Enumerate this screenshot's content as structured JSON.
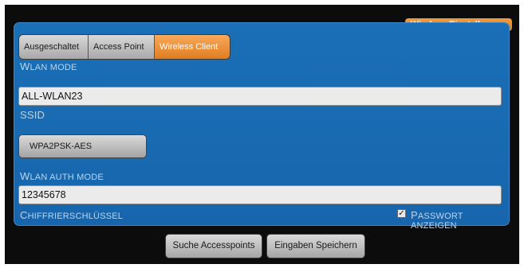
{
  "header": {
    "badge": "Wireless Einstellungen"
  },
  "mode_tabs": [
    {
      "label": "Ausgeschaltet",
      "active": false
    },
    {
      "label": "Access Point",
      "active": false
    },
    {
      "label": "Wireless Client",
      "active": true
    }
  ],
  "wlan_mode": {
    "label_first": "W",
    "label_rest": "LAN MODE"
  },
  "ssid": {
    "value": "ALL-WLAN23",
    "label": "SSID"
  },
  "auth": {
    "selected": "WPA2PSK-AES",
    "label_first": "W",
    "label_rest": "LAN AUTH MODE"
  },
  "key": {
    "value": "12345678",
    "label_first": "C",
    "label_rest": "HIFFRIERSCHLÜSSEL"
  },
  "show_password": {
    "checked": true,
    "check_mark": "✓",
    "label_first": "P",
    "label_rest": "ASSWORT ANZEIGEN"
  },
  "buttons": {
    "search": "Suche Accesspoints",
    "save": "Eingaben Speichern"
  },
  "colors": {
    "panel": "#1a6fb6",
    "accent": "#e17d21",
    "label": "#b9d4ee"
  }
}
